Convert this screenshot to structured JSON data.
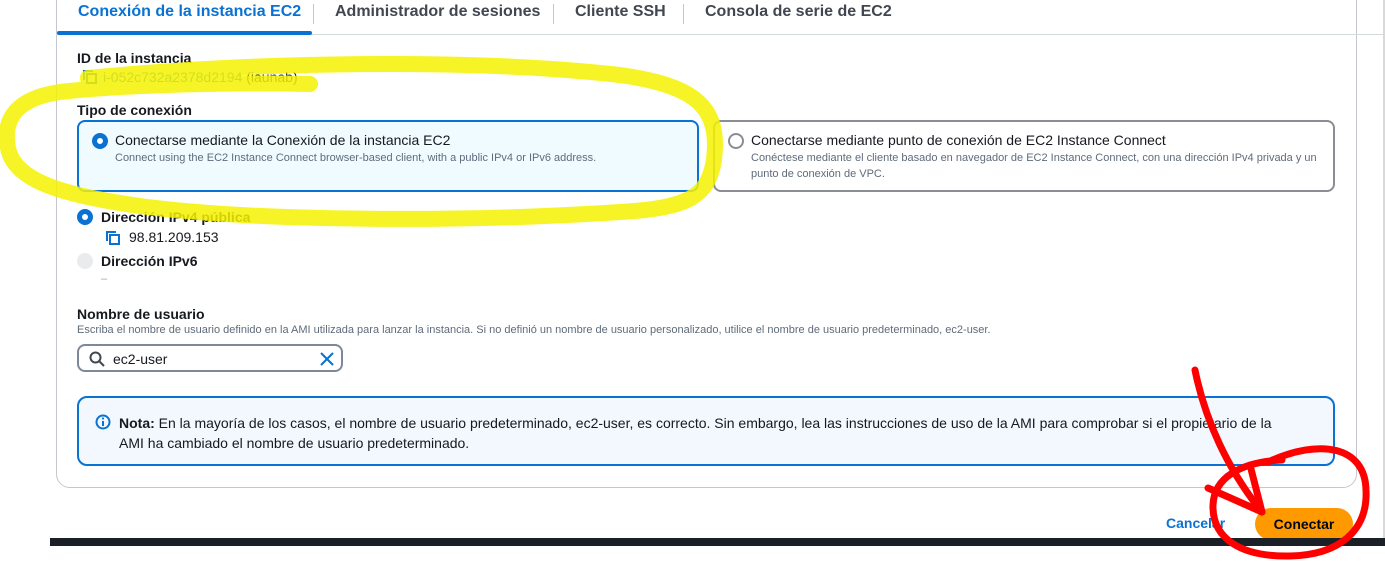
{
  "tabs": [
    {
      "label": "Conexión de la instancia EC2",
      "active": true
    },
    {
      "label": "Administrador de sesiones",
      "active": false
    },
    {
      "label": "Cliente SSH",
      "active": false
    },
    {
      "label": "Consola de serie de EC2",
      "active": false
    }
  ],
  "instance": {
    "label": "ID de la instancia",
    "id": "i-052c732a2378d2194",
    "name": "(iaunab)"
  },
  "connection_type": {
    "label": "Tipo de conexión",
    "options": [
      {
        "title": "Conectarse mediante la Conexión de la instancia EC2",
        "description": "Connect using the EC2 Instance Connect browser-based client, with a public IPv4 or IPv6 address.",
        "selected": true
      },
      {
        "title": "Conectarse mediante punto de conexión de EC2 Instance Connect",
        "description": "Conéctese mediante el cliente basado en navegador de EC2 Instance Connect, con una dirección IPv4 privada y un punto de conexión de VPC.",
        "selected": false
      }
    ]
  },
  "address": {
    "ipv4_label": "Dirección IPv4 pública",
    "ipv4_value": "98.81.209.153",
    "ipv6_label": "Dirección IPv6",
    "ipv6_value": "–"
  },
  "username": {
    "label": "Nombre de usuario",
    "help": "Escriba el nombre de usuario definido en la AMI utilizada para lanzar la instancia. Si no definió un nombre de usuario personalizado, utilice el nombre de usuario predeterminado, ec2-user.",
    "value": "ec2-user"
  },
  "note": {
    "bold": "Nota:",
    "text": " En la mayoría de los casos, el nombre de usuario predeterminado, ec2-user, es correcto. Sin embargo, lea las instrucciones de uso de la AMI para comprobar si el propietario de la AMI ha cambiado el nombre de usuario predeterminado."
  },
  "actions": {
    "cancel": "Cancelar",
    "connect": "Conectar"
  },
  "colors": {
    "accent": "#0972d3",
    "primary_button": "#ff9900",
    "highlight_yellow": "#f5f200",
    "annotation_red": "#ff0000"
  }
}
